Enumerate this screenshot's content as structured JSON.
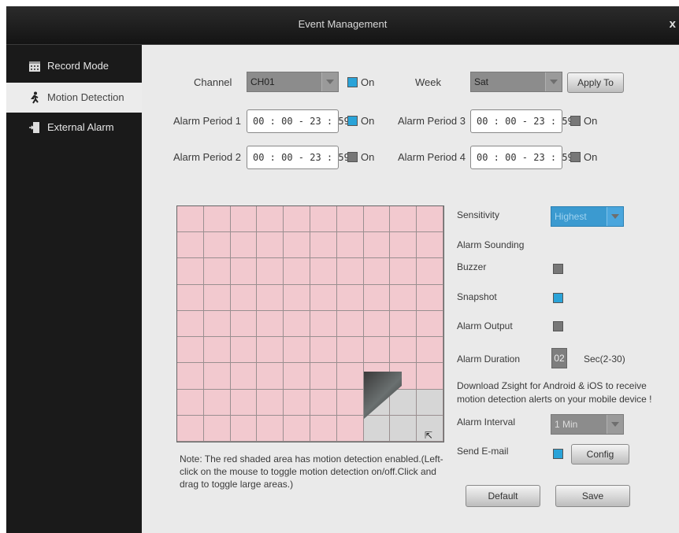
{
  "window": {
    "title": "Event Management",
    "close_label": "x"
  },
  "sidebar": {
    "items": [
      {
        "label": "Record Mode",
        "icon": "calendar-icon"
      },
      {
        "label": "Motion Detection",
        "icon": "running-person-icon",
        "active": true
      },
      {
        "label": "External Alarm",
        "icon": "door-exit-icon"
      }
    ]
  },
  "form": {
    "channel": {
      "label": "Channel",
      "value": "CH01",
      "on_label": "On",
      "on": true
    },
    "week": {
      "label": "Week",
      "value": "Sat"
    },
    "apply_label": "Apply To",
    "periods": [
      {
        "label": "Alarm Period 1",
        "value": "00 : 00 - 23 : 59",
        "on_label": "On",
        "on": true
      },
      {
        "label": "Alarm Period 2",
        "value": "00 : 00 - 23 : 59",
        "on_label": "On",
        "on": false
      },
      {
        "label": "Alarm Period 3",
        "value": "00 : 00 - 23 : 59",
        "on_label": "On",
        "on": false
      },
      {
        "label": "Alarm Period 4",
        "value": "00 : 00 - 23 : 59",
        "on_label": "On",
        "on": false
      }
    ]
  },
  "settings": {
    "sensitivity": {
      "label": "Sensitivity",
      "value": "Highest"
    },
    "alarm_sounding": "Alarm Sounding",
    "buzzer": {
      "label": "Buzzer",
      "on": false
    },
    "snapshot": {
      "label": "Snapshot",
      "on": true
    },
    "alarm_output": {
      "label": "Alarm Output",
      "on": false
    },
    "alarm_duration": {
      "label": "Alarm Duration",
      "value": "02",
      "unit": "Sec(2-30)"
    },
    "download_note": "Download Zsight for Android & iOS to receive motion detection alerts on your mobile device !",
    "alarm_interval": {
      "label": "Alarm Interval",
      "value": "1 Min"
    },
    "send_email": {
      "label": "Send E-mail",
      "on": true,
      "config_label": "Config"
    }
  },
  "note": "Note: The red shaded area has motion detection enabled.(Left-click on the mouse to toggle motion detection on/off.Click and drag to toggle large areas.)",
  "buttons": {
    "default_label": "Default",
    "save_label": "Save"
  },
  "grid": {
    "rows": 9,
    "cols": 10,
    "clear_cells": [
      [
        7,
        7
      ],
      [
        7,
        8
      ],
      [
        7,
        9
      ],
      [
        8,
        7
      ],
      [
        8,
        8
      ],
      [
        8,
        9
      ]
    ]
  },
  "colors": {
    "accent": "#2aa3d8",
    "motion_cell": "#f2c9cf",
    "sidebar_bg": "#1a1a1a",
    "content_bg": "#eaeaea"
  }
}
